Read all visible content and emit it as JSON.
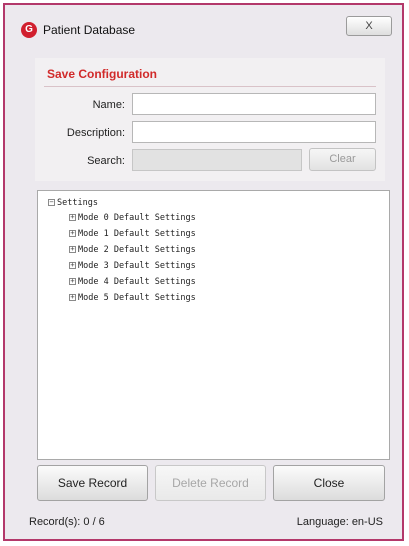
{
  "window": {
    "title": "Patient Database",
    "close_button": "X"
  },
  "config": {
    "title": "Save Configuration",
    "name_label": "Name:",
    "name_value": "",
    "description_label": "Description:",
    "description_value": "",
    "search_label": "Search:",
    "search_value": "",
    "clear_label": "Clear"
  },
  "tree": {
    "root_label": "Settings",
    "items": [
      {
        "label": "Mode 0 Default Settings"
      },
      {
        "label": "Mode 1 Default Settings"
      },
      {
        "label": "Mode 2 Default Settings"
      },
      {
        "label": "Mode 3 Default Settings"
      },
      {
        "label": "Mode 4 Default Settings"
      },
      {
        "label": "Mode 5 Default Settings"
      }
    ]
  },
  "buttons": {
    "save": "Save Record",
    "delete": "Delete Record",
    "close": "Close"
  },
  "status": {
    "records": "Record(s): 0 / 6",
    "language": "Language: en-US"
  },
  "colors": {
    "window_border": "#b3386a",
    "accent_red": "#d12a2a",
    "window_bg": "#ece9ee"
  }
}
